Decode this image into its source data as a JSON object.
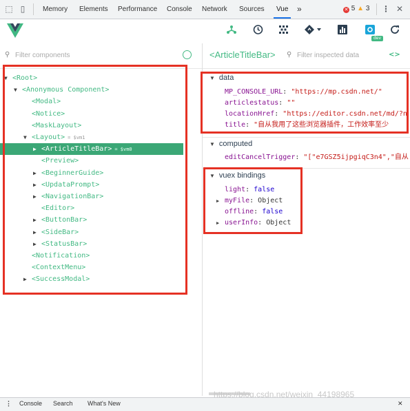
{
  "devtools": {
    "tabs": [
      "Memory",
      "Elements",
      "Performance",
      "Console",
      "Network",
      "Sources",
      "Vue"
    ],
    "active_tab": "Vue",
    "more": "»",
    "errors": "5",
    "warnings": "3"
  },
  "vue_toolbar": {
    "dev_badge": "dev",
    "tools": [
      "components-icon",
      "history-icon",
      "vuex-icon",
      "routing-icon",
      "performance-icon",
      "settings-icon",
      "refresh-icon"
    ]
  },
  "components": {
    "filter_placeholder": "Filter components",
    "tree": [
      {
        "label": "<Root>",
        "arrow": "▼"
      },
      {
        "label": "<Anonymous Component>",
        "arrow": "▼"
      },
      {
        "label": "<Modal>",
        "arrow": ""
      },
      {
        "label": "<Notice>",
        "arrow": ""
      },
      {
        "label": "<MaskLayout>",
        "arrow": ""
      },
      {
        "label": "<Layout>",
        "arrow": "▼",
        "ref": "= $vm1"
      },
      {
        "label": "<ArticleTitleBar>",
        "arrow": "▶",
        "ref": "= $vm0",
        "selected": true
      },
      {
        "label": "<Preview>",
        "arrow": ""
      },
      {
        "label": "<BeginnerGuide>",
        "arrow": "▶"
      },
      {
        "label": "<UpdataPrompt>",
        "arrow": "▶"
      },
      {
        "label": "<NavigationBar>",
        "arrow": "▶"
      },
      {
        "label": "<Editor>",
        "arrow": ""
      },
      {
        "label": "<ButtonBar>",
        "arrow": "▶"
      },
      {
        "label": "<SideBar>",
        "arrow": "▶"
      },
      {
        "label": "<StatusBar>",
        "arrow": "▶"
      },
      {
        "label": "<Notification>",
        "arrow": ""
      },
      {
        "label": "<ContextMenu>",
        "arrow": ""
      },
      {
        "label": "<SuccessModal>",
        "arrow": "▶"
      }
    ]
  },
  "inspector": {
    "title": "<ArticleTitleBar>",
    "filter_placeholder": "Filter inspected data",
    "code_icon": "<>",
    "data_header": "data",
    "data": [
      {
        "key": "MP_CONSOLE_URL",
        "value": "\"https://mp.csdn.net/\""
      },
      {
        "key": "articlestatus",
        "value": "\"\""
      },
      {
        "key": "locationHref",
        "value": "\"https://editor.csdn.net/md/?n"
      },
      {
        "key": "title",
        "value": "\"自从我用了这些浏览器插件，工作效率至少"
      }
    ],
    "computed_header": "computed",
    "computed": [
      {
        "key": "editCancelTrigger",
        "value": "\"[\"e7GSZ5ijpgiqC3n4\",\"自从"
      }
    ],
    "vuex_header": "vuex bindings",
    "vuex": [
      {
        "key": "light",
        "value": "false",
        "type": "bool"
      },
      {
        "key": "myFile",
        "value": "Object",
        "type": "obj",
        "expand": "▶"
      },
      {
        "key": "offline",
        "value": "false",
        "type": "bool"
      },
      {
        "key": "userInfo",
        "value": "Object",
        "type": "obj",
        "expand": "▶"
      }
    ]
  },
  "bottom": {
    "tabs": [
      "Console",
      "Search",
      "What's New"
    ],
    "watermark": "https://blog.csdn.net/weixin_44198965"
  }
}
